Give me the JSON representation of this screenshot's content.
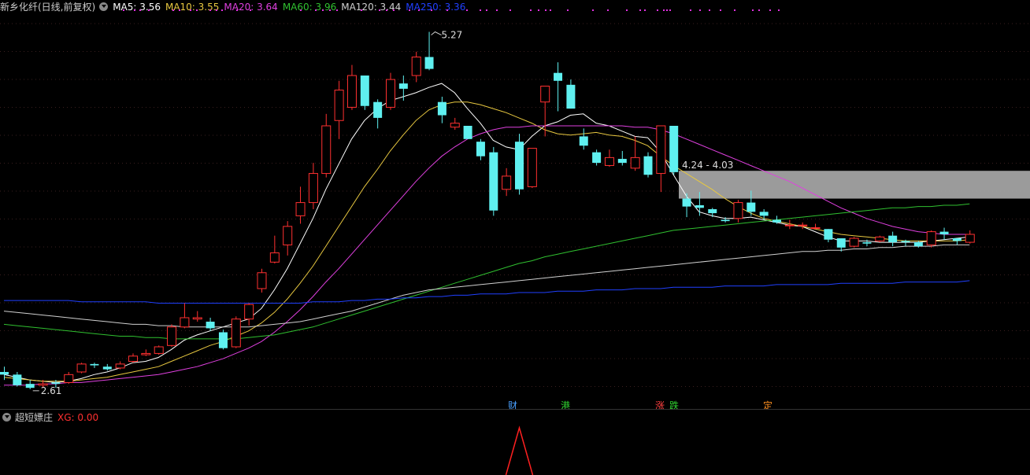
{
  "header": {
    "title": "新乡化纤(日线,前复权)",
    "ma": [
      {
        "label": "MA5: 3.56",
        "color": "#ffffff"
      },
      {
        "label": "MA10: 3.55",
        "color": "#e8c840"
      },
      {
        "label": "MA20: 3.64",
        "color": "#e040e0"
      },
      {
        "label": "MA60: 3.96",
        "color": "#30c030"
      },
      {
        "label": "MA120: 3.44",
        "color": "#d0d0d0"
      },
      {
        "label": "MA250: 3.36",
        "color": "#2040ff"
      }
    ]
  },
  "annotations": {
    "high_label": "5.27",
    "low_label": "2.61",
    "gap_label": "4.24 - 4.03"
  },
  "markers": [
    {
      "text": "财",
      "color": "#4aa0ff"
    },
    {
      "text": "港",
      "color": "#30d030"
    },
    {
      "text": "涨",
      "color": "#ff4040"
    },
    {
      "text": "跌",
      "color": "#30d030"
    },
    {
      "text": "定",
      "color": "#ff9020"
    }
  ],
  "sub_panel": {
    "title": "超短嫖庄",
    "xg_label": "XG: 0.00",
    "xg_color": "#ff3030"
  },
  "chart_data": {
    "type": "candlestick",
    "ylim": [
      2.5,
      5.4
    ],
    "up_color": "#ff3030",
    "down_color": "#5ff0f0",
    "candles": [
      [
        2.72,
        2.7,
        2.76,
        2.66
      ],
      [
        2.7,
        2.62,
        2.72,
        2.61
      ],
      [
        2.63,
        2.6,
        2.66,
        2.59
      ],
      [
        2.62,
        2.63,
        2.66,
        2.6
      ],
      [
        2.64,
        2.63,
        2.66,
        2.6
      ],
      [
        2.64,
        2.7,
        2.72,
        2.63
      ],
      [
        2.72,
        2.78,
        2.79,
        2.71
      ],
      [
        2.78,
        2.77,
        2.79,
        2.75
      ],
      [
        2.76,
        2.74,
        2.78,
        2.73
      ],
      [
        2.75,
        2.78,
        2.8,
        2.74
      ],
      [
        2.8,
        2.84,
        2.86,
        2.79
      ],
      [
        2.85,
        2.86,
        2.89,
        2.84
      ],
      [
        2.86,
        2.91,
        2.92,
        2.85
      ],
      [
        2.92,
        3.06,
        3.08,
        2.91
      ],
      [
        3.06,
        3.13,
        3.24,
        3.05
      ],
      [
        3.12,
        3.13,
        3.18,
        3.1
      ],
      [
        3.1,
        3.05,
        3.13,
        3.03
      ],
      [
        3.02,
        2.9,
        3.04,
        2.89
      ],
      [
        2.91,
        3.12,
        3.14,
        2.9
      ],
      [
        3.12,
        3.23,
        3.24,
        3.07
      ],
      [
        3.35,
        3.47,
        3.5,
        3.32
      ],
      [
        3.55,
        3.62,
        3.75,
        3.54
      ],
      [
        3.68,
        3.82,
        3.86,
        3.6
      ],
      [
        3.9,
        4.0,
        4.12,
        3.84
      ],
      [
        4.0,
        4.22,
        4.3,
        3.95
      ],
      [
        4.22,
        4.58,
        4.67,
        4.19
      ],
      [
        4.62,
        4.85,
        4.92,
        4.48
      ],
      [
        4.72,
        4.96,
        5.04,
        4.7
      ],
      [
        4.96,
        4.73,
        4.96,
        4.7
      ],
      [
        4.76,
        4.64,
        4.78,
        4.56
      ],
      [
        4.72,
        4.93,
        4.98,
        4.7
      ],
      [
        4.9,
        4.86,
        4.96,
        4.77
      ],
      [
        4.96,
        5.1,
        5.14,
        4.91
      ],
      [
        5.1,
        5.01,
        5.29,
        5.0
      ],
      [
        4.76,
        4.66,
        4.8,
        4.6
      ],
      [
        4.57,
        4.6,
        4.64,
        4.55
      ],
      [
        4.58,
        4.48,
        4.58,
        4.5
      ],
      [
        4.46,
        4.35,
        4.48,
        4.32
      ],
      [
        4.38,
        3.94,
        4.42,
        3.9
      ],
      [
        4.1,
        4.2,
        4.26,
        4.05
      ],
      [
        4.46,
        4.1,
        4.52,
        4.06
      ],
      [
        4.12,
        4.41,
        4.4,
        4.11
      ],
      [
        4.76,
        4.88,
        4.88,
        4.5
      ],
      [
        4.98,
        4.92,
        5.06,
        4.69
      ],
      [
        4.89,
        4.71,
        4.93,
        4.71
      ],
      [
        4.5,
        4.43,
        4.56,
        4.4
      ],
      [
        4.38,
        4.3,
        4.4,
        4.28
      ],
      [
        4.28,
        4.34,
        4.4,
        4.27
      ],
      [
        4.33,
        4.3,
        4.39,
        4.28
      ],
      [
        4.26,
        4.34,
        4.5,
        4.24
      ],
      [
        4.35,
        4.21,
        4.38,
        4.19
      ],
      [
        4.22,
        4.58,
        4.58,
        4.08
      ],
      [
        4.58,
        4.23,
        4.58,
        4.21
      ],
      [
        4.03,
        3.97,
        4.07,
        3.89
      ],
      [
        3.98,
        3.96,
        4.08,
        3.9
      ],
      [
        3.95,
        3.92,
        3.96,
        3.89
      ],
      [
        3.87,
        3.86,
        3.89,
        3.85
      ],
      [
        3.88,
        4.0,
        4.02,
        3.85
      ],
      [
        4.0,
        3.93,
        4.09,
        3.9
      ],
      [
        3.93,
        3.9,
        3.95,
        3.87
      ],
      [
        3.87,
        3.85,
        3.9,
        3.84
      ],
      [
        3.83,
        3.83,
        3.87,
        3.8
      ],
      [
        3.83,
        3.83,
        3.85,
        3.8
      ],
      [
        3.81,
        3.81,
        3.84,
        3.8
      ],
      [
        3.8,
        3.72,
        3.8,
        3.7
      ],
      [
        3.73,
        3.66,
        3.73,
        3.63
      ],
      [
        3.67,
        3.73,
        3.74,
        3.66
      ],
      [
        3.7,
        3.69,
        3.72,
        3.67
      ],
      [
        3.71,
        3.74,
        3.75,
        3.7
      ],
      [
        3.75,
        3.7,
        3.78,
        3.67
      ],
      [
        3.71,
        3.7,
        3.72,
        3.67
      ],
      [
        3.7,
        3.67,
        3.71,
        3.66
      ],
      [
        3.68,
        3.78,
        3.79,
        3.66
      ],
      [
        3.78,
        3.76,
        3.81,
        3.72
      ],
      [
        3.73,
        3.71,
        3.73,
        3.68
      ],
      [
        3.7,
        3.76,
        3.79,
        3.69
      ]
    ],
    "ma_series": [
      {
        "name": "MA5",
        "color": "#ffffff",
        "values": [
          2.7,
          2.68,
          2.66,
          2.65,
          2.64,
          2.65,
          2.67,
          2.7,
          2.72,
          2.75,
          2.79,
          2.8,
          2.83,
          2.89,
          2.96,
          3.0,
          3.03,
          3.06,
          3.09,
          3.12,
          3.2,
          3.34,
          3.5,
          3.69,
          3.88,
          4.1,
          4.29,
          4.48,
          4.62,
          4.71,
          4.77,
          4.8,
          4.83,
          4.87,
          4.9,
          4.83,
          4.71,
          4.6,
          4.47,
          4.42,
          4.4,
          4.5,
          4.58,
          4.61,
          4.66,
          4.67,
          4.6,
          4.58,
          4.54,
          4.5,
          4.49,
          4.38,
          4.21,
          4.05,
          3.93,
          3.9,
          3.88,
          3.88,
          3.89,
          3.87,
          3.85,
          3.83,
          3.82,
          3.78,
          3.74,
          3.71,
          3.71,
          3.71,
          3.7,
          3.7,
          3.7,
          3.7,
          3.71,
          3.72,
          3.73,
          3.74
        ]
      },
      {
        "name": "MA10",
        "color": "#e8c840",
        "values": [
          2.68,
          2.67,
          2.66,
          2.65,
          2.65,
          2.65,
          2.66,
          2.67,
          2.68,
          2.7,
          2.72,
          2.74,
          2.76,
          2.8,
          2.84,
          2.88,
          2.92,
          2.95,
          2.99,
          3.03,
          3.09,
          3.17,
          3.27,
          3.39,
          3.52,
          3.67,
          3.82,
          3.97,
          4.12,
          4.25,
          4.39,
          4.51,
          4.62,
          4.7,
          4.74,
          4.76,
          4.76,
          4.74,
          4.71,
          4.68,
          4.64,
          4.6,
          4.55,
          4.52,
          4.51,
          4.52,
          4.53,
          4.51,
          4.5,
          4.47,
          4.43,
          4.35,
          4.28,
          4.22,
          4.16,
          4.1,
          4.03,
          3.97,
          3.92,
          3.88,
          3.86,
          3.84,
          3.82,
          3.8,
          3.78,
          3.76,
          3.75,
          3.74,
          3.73,
          3.72,
          3.71,
          3.71,
          3.71,
          3.71,
          3.71,
          3.72
        ]
      },
      {
        "name": "MA20",
        "color": "#e040e0",
        "values": [
          2.62,
          2.62,
          2.62,
          2.63,
          2.63,
          2.64,
          2.64,
          2.65,
          2.66,
          2.67,
          2.68,
          2.69,
          2.7,
          2.72,
          2.74,
          2.76,
          2.79,
          2.82,
          2.86,
          2.9,
          2.95,
          3.02,
          3.1,
          3.19,
          3.29,
          3.4,
          3.5,
          3.61,
          3.72,
          3.83,
          3.94,
          4.05,
          4.16,
          4.26,
          4.35,
          4.42,
          4.48,
          4.52,
          4.55,
          4.57,
          4.57,
          4.58,
          4.58,
          4.58,
          4.58,
          4.58,
          4.58,
          4.58,
          4.58,
          4.57,
          4.57,
          4.55,
          4.52,
          4.48,
          4.44,
          4.4,
          4.36,
          4.32,
          4.28,
          4.24,
          4.2,
          4.16,
          4.11,
          4.06,
          4.01,
          3.96,
          3.92,
          3.88,
          3.85,
          3.82,
          3.8,
          3.78,
          3.77,
          3.76,
          3.76,
          3.76
        ]
      },
      {
        "name": "MA60",
        "color": "#30c030",
        "values": [
          3.08,
          3.07,
          3.06,
          3.05,
          3.04,
          3.03,
          3.02,
          3.01,
          3.0,
          2.99,
          2.99,
          2.98,
          2.98,
          2.97,
          2.97,
          2.97,
          2.97,
          2.97,
          2.97,
          2.98,
          2.99,
          3.0,
          3.02,
          3.04,
          3.06,
          3.09,
          3.12,
          3.15,
          3.18,
          3.21,
          3.24,
          3.27,
          3.3,
          3.33,
          3.36,
          3.39,
          3.42,
          3.45,
          3.48,
          3.51,
          3.54,
          3.56,
          3.59,
          3.61,
          3.63,
          3.65,
          3.67,
          3.69,
          3.71,
          3.73,
          3.75,
          3.77,
          3.79,
          3.8,
          3.81,
          3.82,
          3.83,
          3.84,
          3.85,
          3.86,
          3.87,
          3.88,
          3.89,
          3.9,
          3.91,
          3.92,
          3.93,
          3.94,
          3.95,
          3.96,
          3.96,
          3.97,
          3.97,
          3.98,
          3.98,
          3.99
        ]
      },
      {
        "name": "MA120",
        "color": "#d0d0d0",
        "values": [
          3.18,
          3.17,
          3.16,
          3.15,
          3.14,
          3.13,
          3.12,
          3.11,
          3.1,
          3.09,
          3.08,
          3.08,
          3.07,
          3.07,
          3.06,
          3.06,
          3.06,
          3.06,
          3.06,
          3.06,
          3.07,
          3.08,
          3.09,
          3.1,
          3.12,
          3.14,
          3.16,
          3.18,
          3.21,
          3.24,
          3.27,
          3.3,
          3.32,
          3.34,
          3.35,
          3.36,
          3.37,
          3.38,
          3.39,
          3.4,
          3.41,
          3.42,
          3.43,
          3.44,
          3.45,
          3.46,
          3.47,
          3.48,
          3.49,
          3.5,
          3.51,
          3.52,
          3.53,
          3.54,
          3.55,
          3.56,
          3.57,
          3.58,
          3.59,
          3.6,
          3.61,
          3.62,
          3.63,
          3.63,
          3.64,
          3.64,
          3.65,
          3.65,
          3.66,
          3.66,
          3.67,
          3.67,
          3.67,
          3.68,
          3.68,
          3.68
        ]
      },
      {
        "name": "MA250",
        "color": "#2040ff",
        "values": [
          3.26,
          3.26,
          3.26,
          3.26,
          3.26,
          3.26,
          3.25,
          3.25,
          3.25,
          3.25,
          3.25,
          3.25,
          3.24,
          3.24,
          3.24,
          3.24,
          3.24,
          3.24,
          3.24,
          3.24,
          3.24,
          3.24,
          3.24,
          3.24,
          3.25,
          3.25,
          3.25,
          3.26,
          3.26,
          3.27,
          3.27,
          3.28,
          3.28,
          3.29,
          3.29,
          3.3,
          3.3,
          3.31,
          3.31,
          3.31,
          3.32,
          3.32,
          3.32,
          3.33,
          3.33,
          3.33,
          3.34,
          3.34,
          3.34,
          3.35,
          3.35,
          3.35,
          3.36,
          3.36,
          3.36,
          3.36,
          3.37,
          3.37,
          3.37,
          3.37,
          3.38,
          3.38,
          3.38,
          3.38,
          3.38,
          3.39,
          3.39,
          3.39,
          3.39,
          3.39,
          3.4,
          3.4,
          3.4,
          3.4,
          3.4,
          3.41
        ]
      }
    ],
    "gap_zone": [
      4.03,
      4.24
    ],
    "sub_signal_index": 40
  }
}
